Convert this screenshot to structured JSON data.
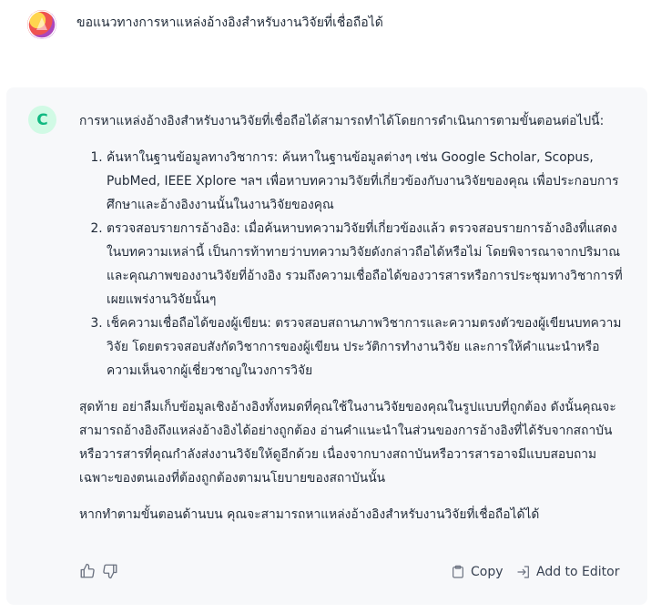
{
  "user": {
    "message": "ขอแนวทางการหาแหล่งอ้างอิงสำหรับงานวิจัยที่เชื่อถือได้"
  },
  "assistant": {
    "avatar_letter": "C",
    "intro": "การหาแหล่งอ้างอิงสำหรับงานวิจัยที่เชื่อถือได้สามารถทำได้โดยการดำเนินการตามขั้นตอนต่อไปนี้:",
    "steps": [
      "ค้นหาในฐานข้อมูลทางวิชาการ: ค้นหาในฐานข้อมูลต่างๆ เช่น Google Scholar, Scopus, PubMed, IEEE Xplore ฯลฯ เพื่อหาบทความวิจัยที่เกี่ยวข้องกับงานวิจัยของคุณ เพื่อประกอบการศึกษาและอ้างอิงงานนั้นในงานวิจัยของคุณ",
      "ตรวจสอบรายการอ้างอิง: เมื่อค้นหาบทความวิจัยที่เกี่ยวข้องแล้ว ตรวจสอบรายการอ้างอิงที่แสดงในบทความเหล่านี้ เป็นการท้าทายว่าบทความวิจัยดังกล่าวถือได้หรือไม่ โดยพิจารณาจากปริมาณและคุณภาพของงานวิจัยที่อ้างอิง รวมถึงความเชื่อถือได้ของวารสารหรือการประชุมทางวิชาการที่เผยแพร่งานวิจัยนั้นๆ",
      "เช็คความเชื่อถือได้ของผู้เขียน: ตรวจสอบสถานภาพวิชาการและความตรงตัวของผู้เขียนบทความวิจัย โดยตรวจสอบสังกัดวิชาการของผู้เขียน ประวัติการทำงานวิจัย และการให้คำแนะนำหรือความเห็นจากผู้เชี่ยวชาญในวงการวิจัย"
    ],
    "final_paragraph": "สุดท้าย อย่าลืมเก็บข้อมูลเชิงอ้างอิงทั้งหมดที่คุณใช้ในงานวิจัยของคุณในรูปแบบที่ถูกต้อง ดังนั้นคุณจะสามารถอ้างอิงถึงแหล่งอ้างอิงได้อย่างถูกต้อง อ่านคำแนะนำในส่วนของการอ้างอิงที่ได้รับจากสถาบันหรือวารสารที่คุณกำลังส่งงานวิจัยให้ดูอีกด้วย เนื่องจากบางสถาบันหรือวารสารอาจมีแบบสอบถามเฉพาะของตนเองที่ต้องถูกต้องตามนโยบายของสถาบันนั้น",
    "closing": "หากทำตามขั้นตอนด้านบน คุณจะสามารถหาแหล่งอ้างอิงสำหรับงานวิจัยที่เชื่อถือได้ได้"
  },
  "actions": {
    "copy_label": "Copy",
    "add_to_editor_label": "Add to Editor",
    "icons": [
      "thumbs-up-icon",
      "thumbs-down-icon",
      "clipboard-icon",
      "add-to-editor-icon"
    ]
  },
  "colors": {
    "card_bg": "#f7f8fa",
    "bot_avatar_bg": "#d1fae5",
    "bot_avatar_fg": "#10b981"
  }
}
